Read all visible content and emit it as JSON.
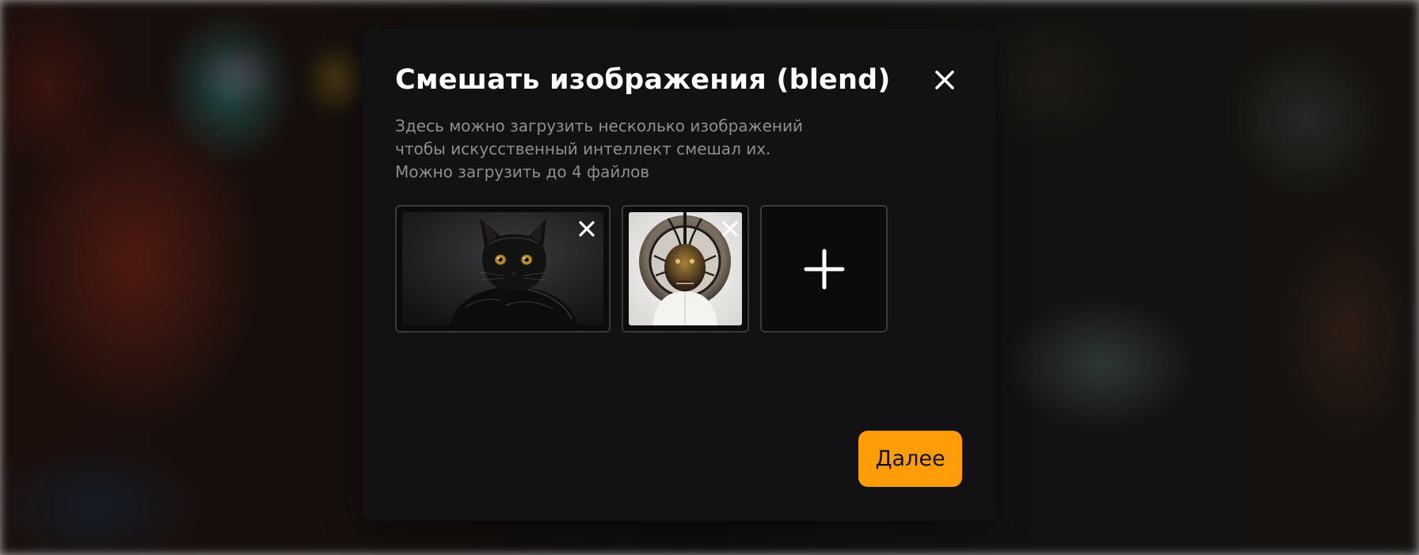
{
  "modal": {
    "title": "Смешать изображения (blend)",
    "description_lines": [
      "Здесь можно загрузить несколько изображений",
      "чтобы искусственный интеллект смешал их.",
      "Можно загрузить до 4 файлов"
    ],
    "close_icon": "close-icon",
    "images": [
      {
        "subject": "black cat",
        "remove_icon": "close-icon"
      },
      {
        "subject": "beetle-headed figure",
        "remove_icon": "close-icon"
      }
    ],
    "add_icon": "plus-icon",
    "next_label": "Далее"
  },
  "colors": {
    "modal_bg": "#121214",
    "accent": "#ff9d09",
    "title": "#ffffff",
    "description": "#8e8e93",
    "tile_border": "#3a3a3d"
  }
}
